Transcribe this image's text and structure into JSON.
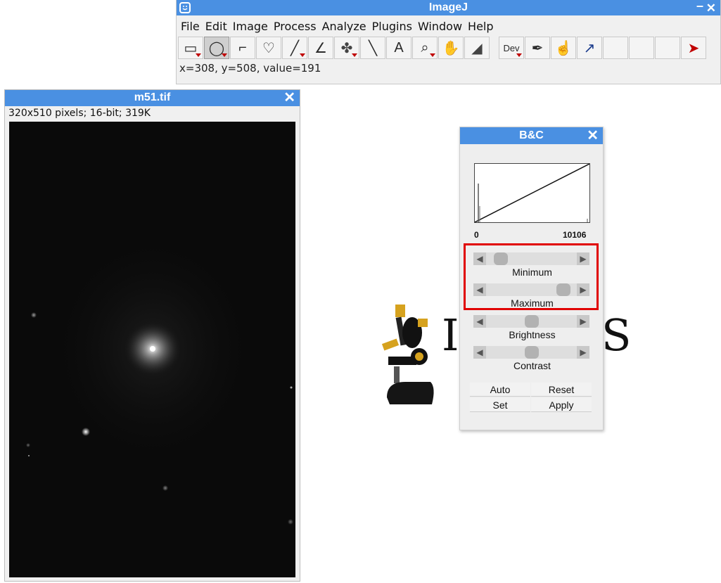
{
  "main_window": {
    "title": "ImageJ",
    "minimize": "–",
    "close": "✕",
    "menus": [
      "File",
      "Edit",
      "Image",
      "Process",
      "Analyze",
      "Plugins",
      "Window",
      "Help"
    ],
    "tools": [
      {
        "name": "rectangle-tool-icon",
        "glyph": "▭",
        "dropdown": true
      },
      {
        "name": "oval-tool-icon",
        "glyph": "◯",
        "dropdown": true,
        "active": true
      },
      {
        "name": "polygon-tool-icon",
        "glyph": "⌐",
        "dropdown": false
      },
      {
        "name": "freehand-tool-icon",
        "glyph": "♡",
        "dropdown": false
      },
      {
        "name": "line-tool-icon",
        "glyph": "╱",
        "dropdown": true
      },
      {
        "name": "angle-tool-icon",
        "glyph": "∠",
        "dropdown": false
      },
      {
        "name": "multipoint-tool-icon",
        "glyph": "✤",
        "dropdown": true
      },
      {
        "name": "wand-tool-icon",
        "glyph": "╲",
        "dropdown": false
      },
      {
        "name": "text-tool-icon",
        "glyph": "A",
        "dropdown": false
      },
      {
        "name": "magnifier-tool-icon",
        "glyph": "⌕",
        "dropdown": true
      },
      {
        "name": "hand-tool-icon",
        "glyph": "✋",
        "dropdown": false
      },
      {
        "name": "dropper-tool-icon",
        "glyph": "◢",
        "dropdown": false
      },
      {
        "name": "dev-menu-icon",
        "glyph": "Dev",
        "dropdown": true,
        "gap_before": true
      },
      {
        "name": "brush-tool-icon",
        "glyph": "✒",
        "dropdown": false
      },
      {
        "name": "flood-fill-tool-icon",
        "glyph": "☝",
        "dropdown": false
      },
      {
        "name": "arrow-tool-icon",
        "glyph": "↗",
        "dropdown": false
      },
      {
        "name": "empty-slot-1",
        "glyph": "",
        "dropdown": false
      },
      {
        "name": "empty-slot-2",
        "glyph": "",
        "dropdown": false
      },
      {
        "name": "empty-slot-3",
        "glyph": "",
        "dropdown": false
      },
      {
        "name": "more-tools-icon",
        "glyph": "➤",
        "dropdown": false
      }
    ],
    "status": "x=308, y=508, value=191"
  },
  "image_window": {
    "title": "m51.tif",
    "info": "320x510 pixels; 16-bit; 319K"
  },
  "background_logo": {
    "text_start": "I",
    "text_end": "S"
  },
  "bc_dialog": {
    "title": "B&C",
    "hist_min_label": "0",
    "hist_max_label": "10106",
    "sliders": {
      "minimum": {
        "label": "Minimum",
        "position": 0.1
      },
      "maximum": {
        "label": "Maximum",
        "position": 0.92
      },
      "brightness": {
        "label": "Brightness",
        "position": 0.5
      },
      "contrast": {
        "label": "Contrast",
        "position": 0.5
      }
    },
    "buttons": {
      "auto": "Auto",
      "reset": "Reset",
      "set": "Set",
      "apply": "Apply"
    }
  },
  "colors": {
    "titlebar": "#4a90e2",
    "highlight": "#e00000"
  }
}
